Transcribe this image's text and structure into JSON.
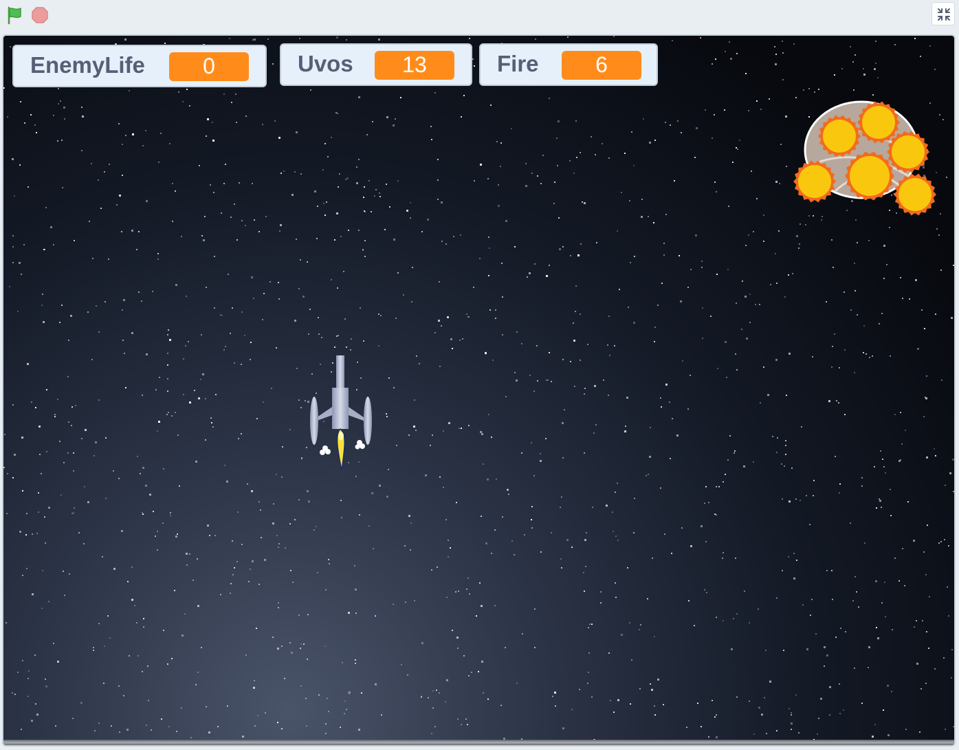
{
  "toolbar": {
    "green_flag_icon": "green-flag-icon",
    "stop_icon": "stop-sign-icon",
    "fullscreen_icon": "exit-fullscreen-icon",
    "flag_color": "#4cbf56",
    "stop_color": "#ec9c9c"
  },
  "monitors": [
    {
      "label": "EnemyLife",
      "value": "0"
    },
    {
      "label": "Uvos",
      "value": "13"
    },
    {
      "label": "Fire",
      "value": "6"
    }
  ],
  "colors": {
    "monitor_value_bg": "#ff8c1a",
    "monitor_label": "#575e75",
    "monitor_bg": "#e6f0fb"
  },
  "sprites": {
    "player": "rocket-ship",
    "enemy": "exploding-enemy-ship"
  }
}
